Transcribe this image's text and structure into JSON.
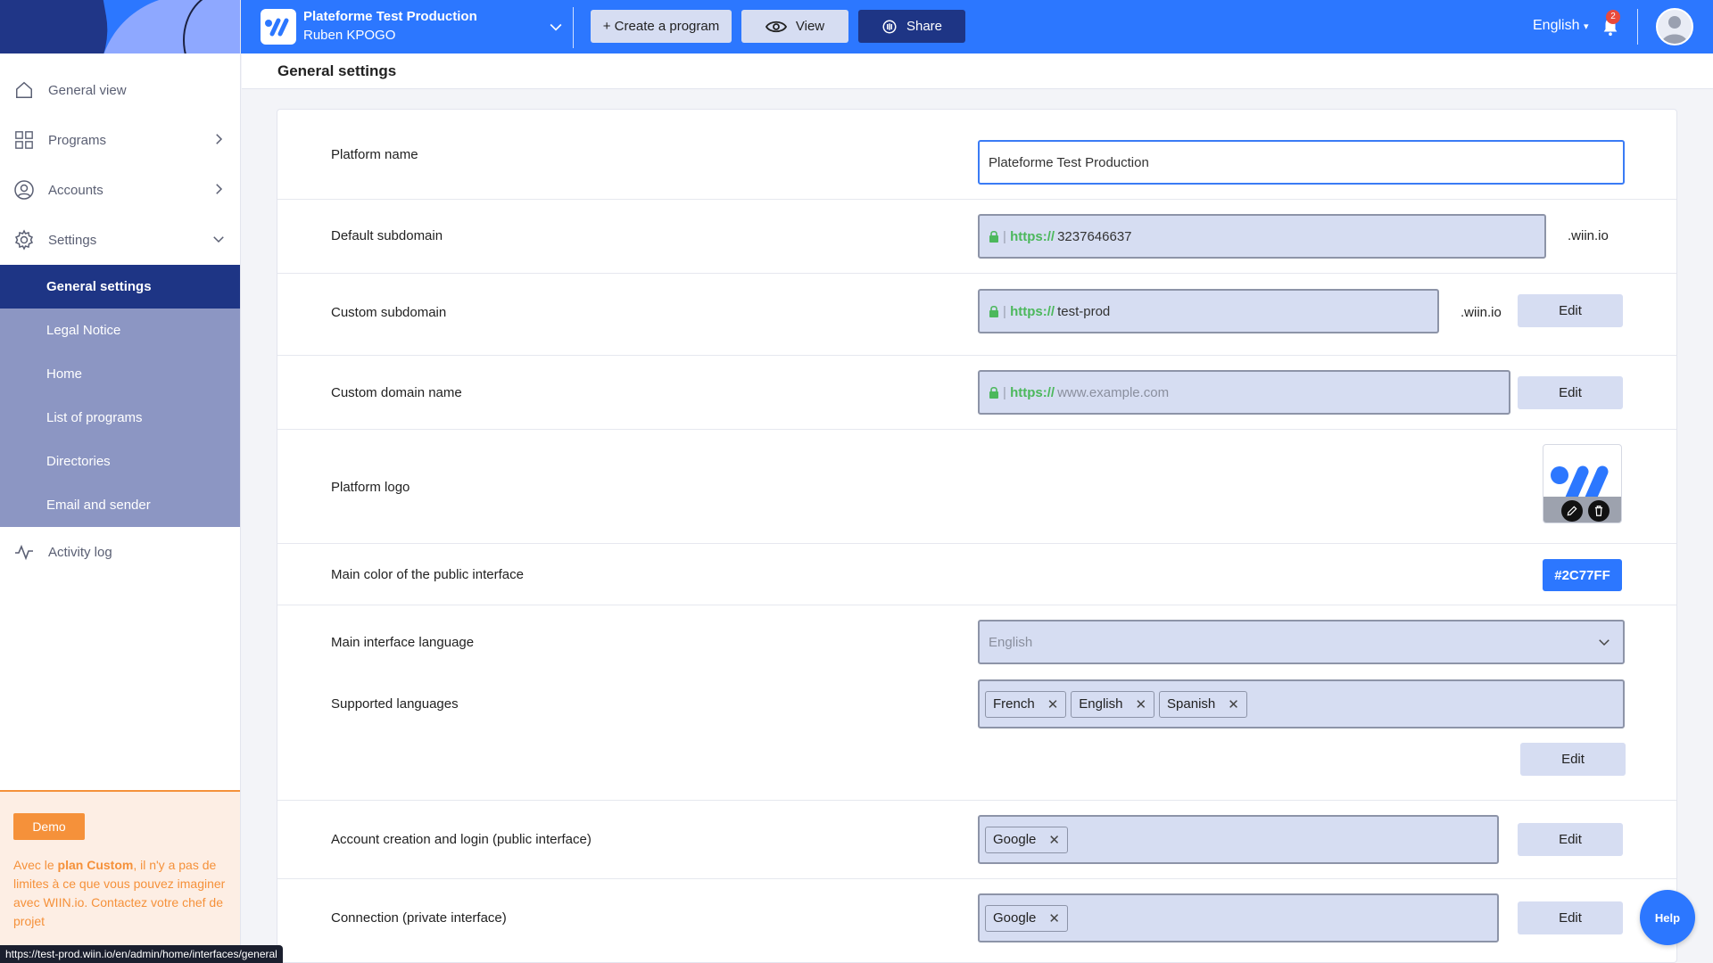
{
  "app": {
    "org_name": "Plateforme Test Production",
    "user_name": "Ruben KPOGO",
    "language": "English",
    "notification_count": "2",
    "brand_color": "#2c77ff"
  },
  "toolbar": {
    "create_label": "+ Create a program",
    "view_label": "View",
    "share_label": "Share"
  },
  "sidebar": {
    "items": [
      {
        "label": "General view",
        "icon": "home-icon"
      },
      {
        "label": "Programs",
        "icon": "grid-icon"
      },
      {
        "label": "Accounts",
        "icon": "user-circle-icon"
      },
      {
        "label": "Settings",
        "icon": "gear-icon"
      }
    ],
    "settings_sub": [
      {
        "label": "General settings",
        "active": true
      },
      {
        "label": "Legal Notice"
      },
      {
        "label": "Home"
      },
      {
        "label": "List of programs"
      },
      {
        "label": "Directories"
      },
      {
        "label": "Email and sender"
      }
    ],
    "activity_label": "Activity log",
    "demo_label": "Demo",
    "demo_text_pre": "Avec le ",
    "demo_text_bold": "plan Custom",
    "demo_text_post": ", il n'y a pas de limites à ce que vous pouvez imaginer avec WIIN.io. Contactez votre chef de projet"
  },
  "status_url": "https://test-prod.wiin.io/en/admin/home/interfaces/general",
  "page": {
    "title": "General settings"
  },
  "settings": {
    "platform_name_label": "Platform name",
    "platform_name_value": "Plateforme Test Production",
    "default_subdomain_label": "Default subdomain",
    "default_subdomain_value": "3237646637",
    "custom_subdomain_label": "Custom subdomain",
    "custom_subdomain_value": "test-prod",
    "custom_domain_label": "Custom domain name",
    "custom_domain_placeholder": "www.example.com",
    "protocol": "https://",
    "protocol_sep": "|",
    "suffix": ".wiin.io",
    "edit_label": "Edit",
    "logo_label": "Platform logo",
    "main_color_label": "Main color of the public interface",
    "main_color_value": "#2C77FF",
    "main_language_label": "Main interface language",
    "main_language_value": "English",
    "supported_languages_label": "Supported languages",
    "supported_languages": [
      "French",
      "English",
      "Spanish"
    ],
    "account_creation_label": "Account creation and login (public interface)",
    "account_creation_tags": [
      "Google"
    ],
    "connection_label": "Connection (private interface)",
    "connection_tags": [
      "Google"
    ],
    "tag_remove": "✕"
  },
  "help_label": "Help"
}
